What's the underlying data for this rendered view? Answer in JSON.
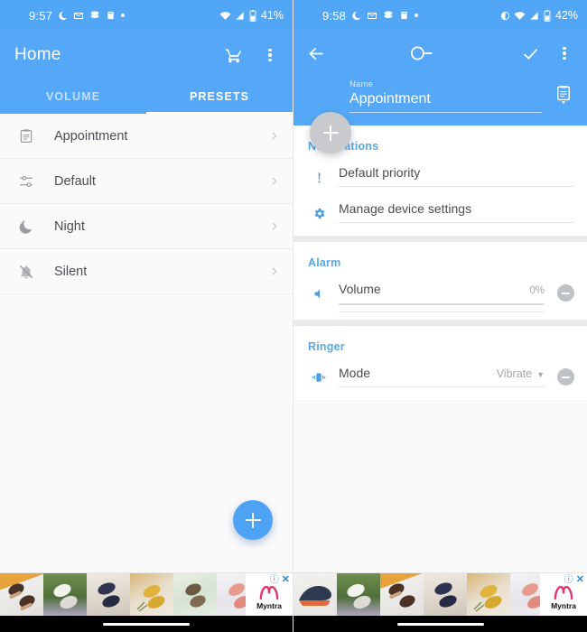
{
  "theme": {
    "primary": "#55a8f7",
    "status_bar": "#52a6f6",
    "accent_section": "#57a8e8",
    "fab": "#4ea3f5",
    "fab_disabled": "#c8cacd",
    "page_bg": "#fafafb",
    "card_gap_bg": "#e8eaec"
  },
  "left_screen": {
    "status_bar": {
      "time": "9:57",
      "battery_text": "41%",
      "left_icons": [
        "moon-dnd-icon",
        "mail-icon",
        "app-icon",
        "clipboard-app-icon",
        "dot-icon"
      ],
      "right_icons": [
        "wifi-icon",
        "signal-icon",
        "battery-icon"
      ]
    },
    "app_bar": {
      "title": "Home",
      "actions": [
        {
          "name": "cart-icon",
          "label": "Cart"
        },
        {
          "name": "overflow-menu-icon",
          "label": "More options"
        }
      ]
    },
    "tabs": [
      {
        "label": "VOLUME",
        "active": false
      },
      {
        "label": "PRESETS",
        "active": true
      }
    ],
    "presets": [
      {
        "label": "Appointment",
        "icon": "clipboard-icon"
      },
      {
        "label": "Default",
        "icon": "tune-sliders-icon"
      },
      {
        "label": "Night",
        "icon": "moon-star-icon"
      },
      {
        "label": "Silent",
        "icon": "bell-off-icon"
      }
    ],
    "fab": {
      "name": "add-preset-fab",
      "icon": "plus-icon"
    },
    "ad": {
      "brand": "Myntra",
      "info_icon": "info-icon",
      "close_icon": "close-icon",
      "thumbs": [
        "shoe-1",
        "shoe-2",
        "shoe-3",
        "shoe-4",
        "shoe-5",
        "shoe-6"
      ]
    }
  },
  "right_screen": {
    "status_bar": {
      "time": "9:58",
      "battery_text": "42%",
      "left_icons": [
        "moon-dnd-icon",
        "mail-icon",
        "app-icon",
        "clipboard-app-icon",
        "dot-icon"
      ],
      "right_icons": [
        "brightness-icon",
        "wifi-icon",
        "signal-icon",
        "battery-icon"
      ]
    },
    "toolbar": {
      "back": "back-arrow-icon",
      "toggle": "power-toggle-icon",
      "confirm": "checkmark-icon",
      "overflow": "overflow-menu-icon"
    },
    "name_field": {
      "label": "Name",
      "value": "Appointment",
      "picker_icon": "clipboard-picker-icon"
    },
    "fab": {
      "name": "add-setting-fab",
      "icon": "plus-icon"
    },
    "sections": [
      {
        "title": "Notifications",
        "rows": [
          {
            "label": "Default priority",
            "value": "",
            "icon": "priority-exclamation-icon",
            "removable": false,
            "slider": false,
            "dropdown": false
          },
          {
            "label": "Manage device settings",
            "value": "",
            "icon": "gear-icon",
            "removable": false,
            "slider": false,
            "dropdown": false
          }
        ]
      },
      {
        "title": "Alarm",
        "rows": [
          {
            "label": "Volume",
            "value": "0%",
            "icon": "volume-icon",
            "removable": true,
            "slider": true,
            "dropdown": false
          }
        ]
      },
      {
        "title": "Ringer",
        "rows": [
          {
            "label": "Mode",
            "value": "Vibrate",
            "icon": "vibrate-icon",
            "removable": true,
            "slider": false,
            "dropdown": true
          }
        ]
      }
    ],
    "ad": {
      "brand": "Myntra",
      "info_icon": "info-icon",
      "close_icon": "close-icon",
      "thumbs": [
        "sneaker-1",
        "shoe-2",
        "shoe-3",
        "shoe-4",
        "shoe-5",
        "shoe-6"
      ]
    }
  }
}
